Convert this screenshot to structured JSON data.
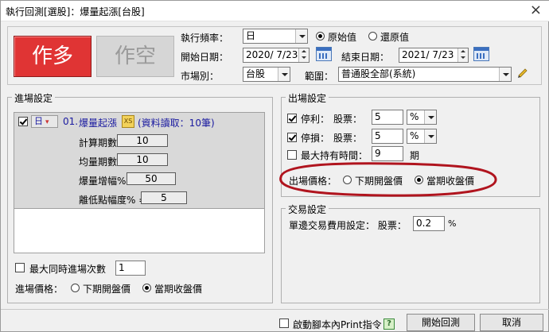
{
  "window": {
    "title": "執行回測[選股]：爆量起漲[台股]",
    "close_glyph": "×"
  },
  "direction": {
    "long_label": "作多",
    "short_label": "作空"
  },
  "top": {
    "freq_label": "執行頻率：",
    "freq_value": "日",
    "radio_original": "原始值",
    "radio_restore": "還原值",
    "start_label": "開始日期：",
    "start_value": "2020/ 7/23",
    "end_label": "結束日期：",
    "end_value": "2021/ 7/23",
    "market_label": "市場別：",
    "market_value": "台股",
    "scope_label": "範圍：",
    "scope_value": "普通股全部(系統)"
  },
  "entry": {
    "group_title": "進場設定",
    "freq_tag": "日",
    "strategy_index": "01.",
    "strategy_name": "爆量起漲",
    "xs_badge": "XS",
    "data_note": "(資料讀取：10筆)",
    "params": [
      {
        "label": "計算期數 =",
        "value": "10"
      },
      {
        "label": "均量期數 =",
        "value": "10"
      },
      {
        "label": "爆量增幅% =",
        "value": "50"
      },
      {
        "label": "離低點幅度% =",
        "value": "5"
      }
    ],
    "max_entries_label": "最大同時進場次數",
    "max_entries_value": "1",
    "price_label": "進場價格：",
    "price_opt_next": "下期開盤價",
    "price_opt_current": "當期收盤價"
  },
  "exit": {
    "group_title": "出場設定",
    "tp_label": "停利：",
    "tp_stock_label": "股票：",
    "tp_value": "5",
    "tp_unit": "%",
    "sl_label": "停損：",
    "sl_stock_label": "股票：",
    "sl_value": "5",
    "sl_unit": "%",
    "hold_label": "最大持有時間：",
    "hold_value": "9",
    "hold_unit": "期",
    "price_label": "出場價格：",
    "price_opt_next": "下期開盤價",
    "price_opt_current": "當期收盤價",
    "highlight_color": "#b0141e"
  },
  "trade": {
    "group_title": "交易設定",
    "fee_label": "單邊交易費用設定： 股票：",
    "fee_value": "0.2",
    "fee_unit": "%"
  },
  "footer": {
    "print_label": "啟動腳本內Print指令",
    "help_glyph": "?",
    "run_label": "開始回測",
    "cancel_label": "取消"
  }
}
